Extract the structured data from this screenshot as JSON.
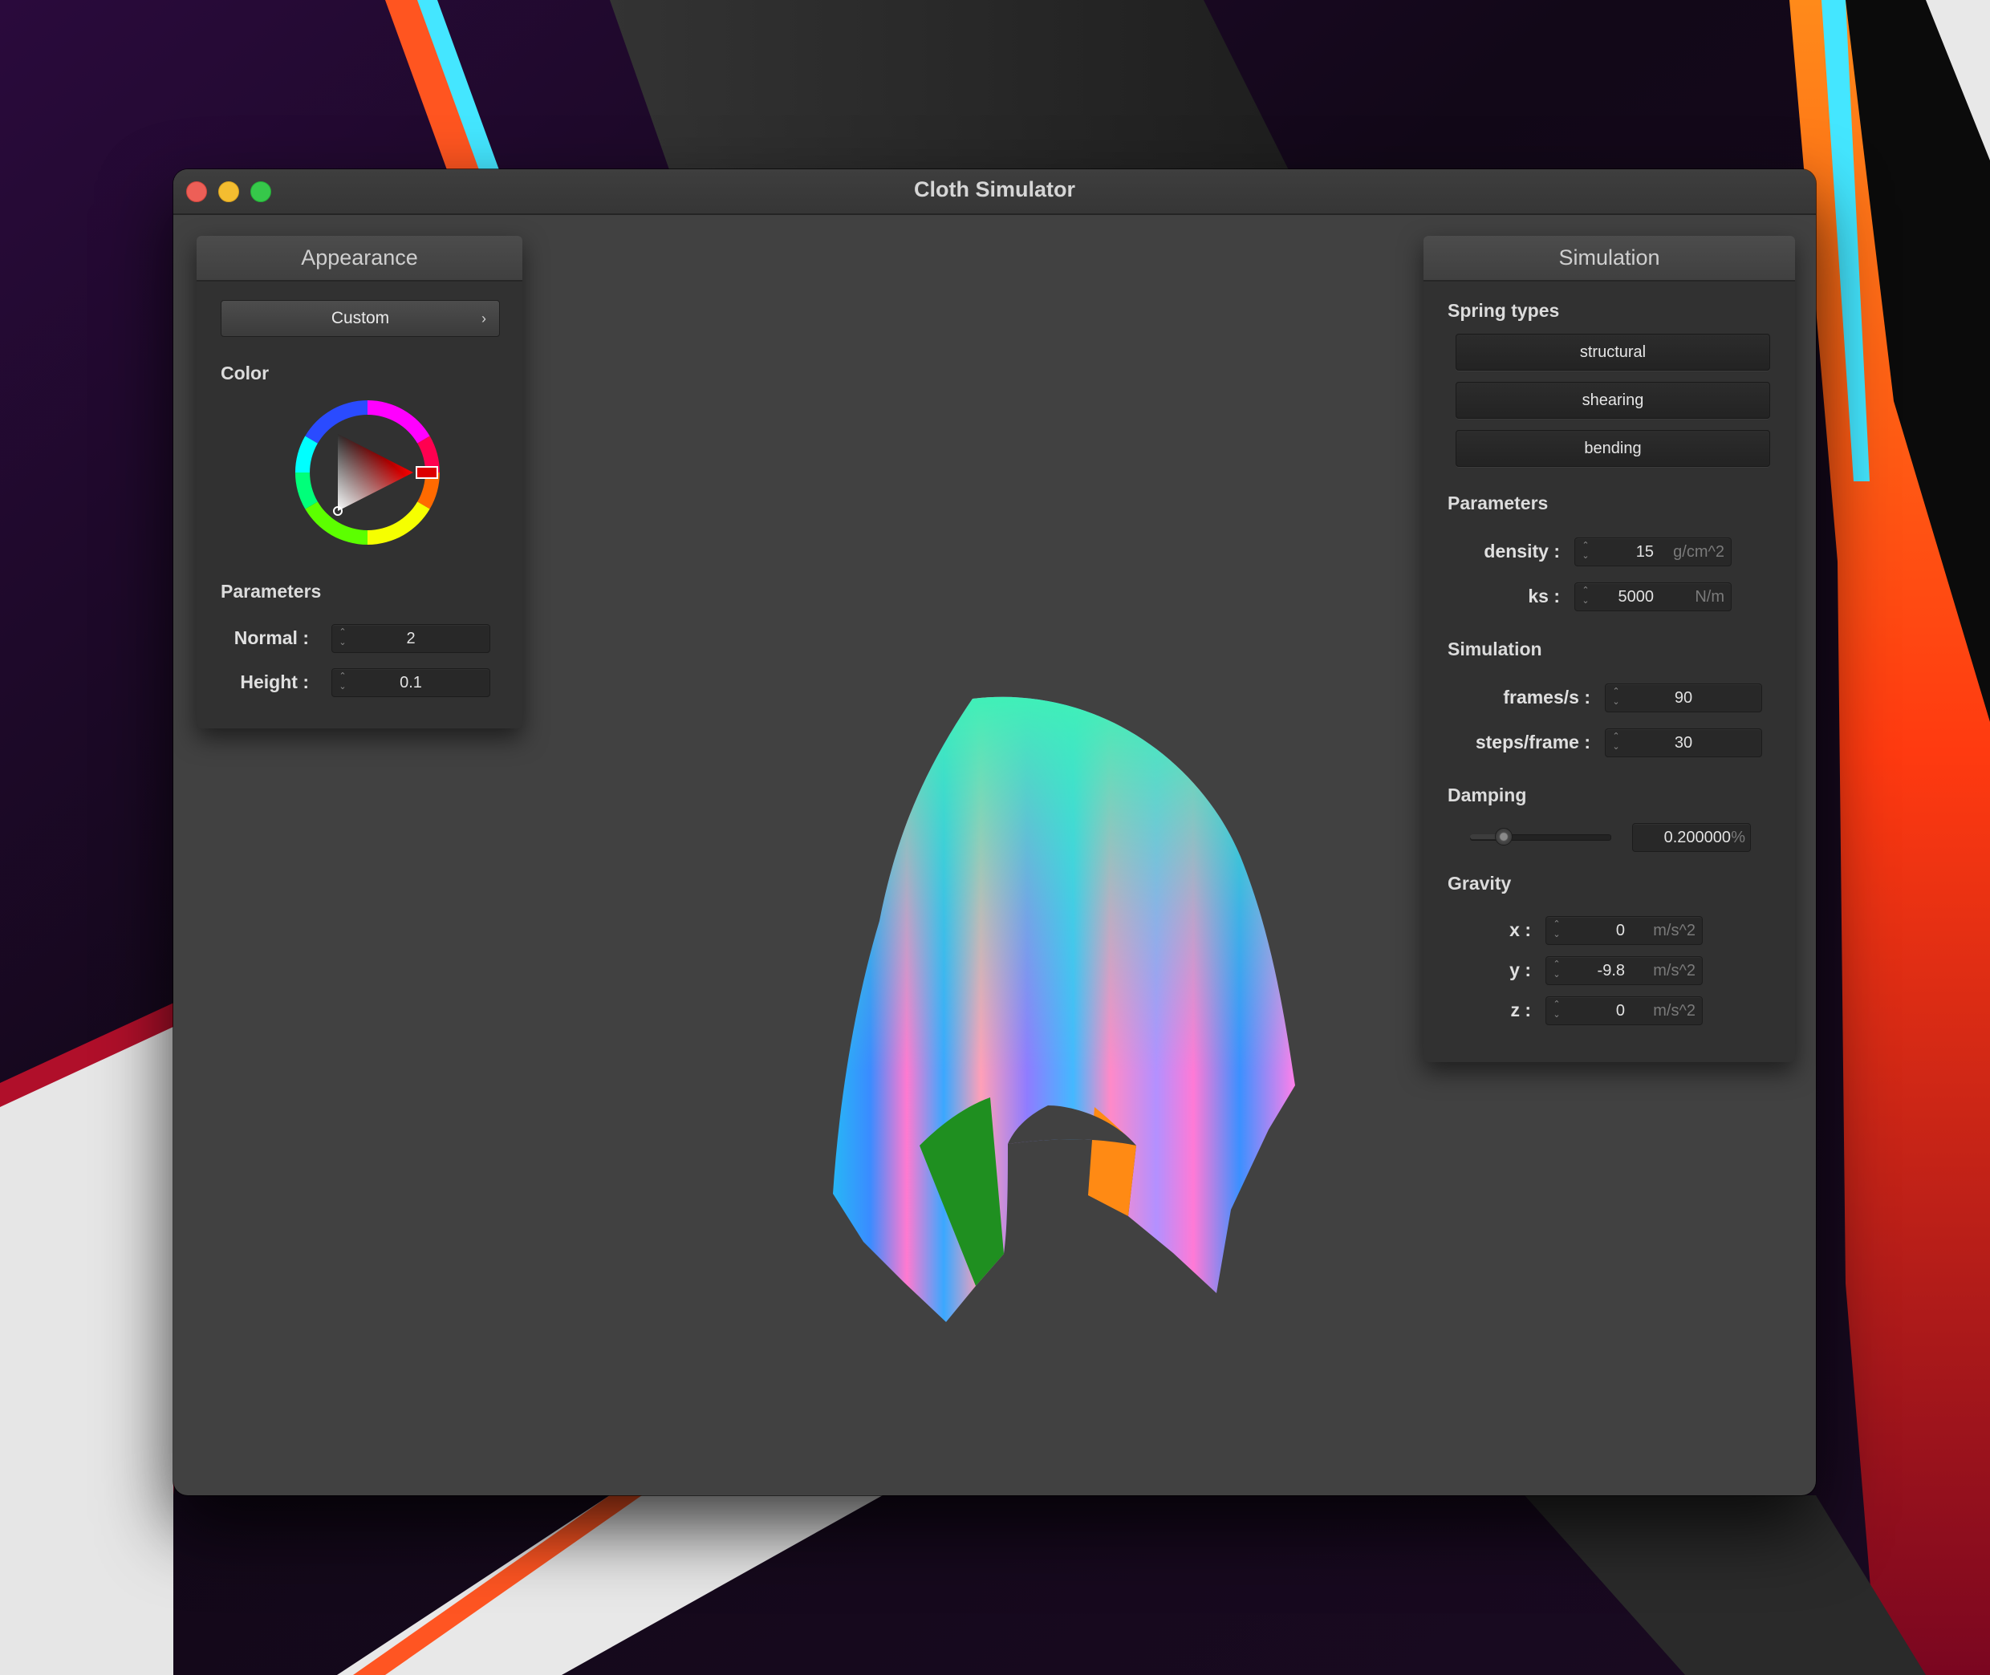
{
  "window": {
    "title": "Cloth Simulator"
  },
  "appearance": {
    "header": "Appearance",
    "preset": "Custom",
    "color_label": "Color",
    "selected_color": "#ff0000",
    "params_label": "Parameters",
    "normal": {
      "label": "Normal :",
      "value": "2"
    },
    "height": {
      "label": "Height :",
      "value": "0.1"
    }
  },
  "simulation": {
    "header": "Simulation",
    "spring_types_label": "Spring types",
    "spring_types": [
      "structural",
      "shearing",
      "bending"
    ],
    "params_label": "Parameters",
    "density": {
      "label": "density :",
      "value": "15",
      "unit": "g/cm^2"
    },
    "ks": {
      "label": "ks :",
      "value": "5000",
      "unit": "N/m"
    },
    "sim_label": "Simulation",
    "fps": {
      "label": "frames/s :",
      "value": "90"
    },
    "steps": {
      "label": "steps/frame :",
      "value": "30"
    },
    "damping_label": "Damping",
    "damping": {
      "value": "0.200000",
      "unit": "%",
      "slider_fraction": 0.2
    },
    "gravity_label": "Gravity",
    "gravity": {
      "x": {
        "label": "x :",
        "value": "0",
        "unit": "m/s^2"
      },
      "y": {
        "label": "y :",
        "value": "-9.8",
        "unit": "m/s^2"
      },
      "z": {
        "label": "z :",
        "value": "0",
        "unit": "m/s^2"
      }
    }
  },
  "icons": {
    "close": "close-icon",
    "minimize": "minimize-icon",
    "maximize": "maximize-icon",
    "chevron": "chevron-right-icon",
    "spin": "spin-arrows-icon"
  }
}
